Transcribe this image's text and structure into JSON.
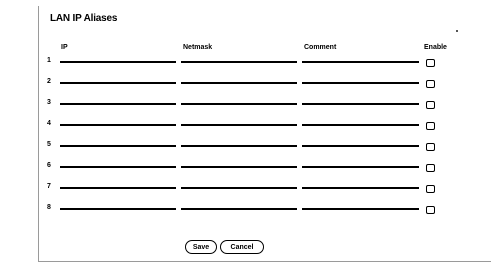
{
  "title": "LAN IP Aliases",
  "columns": {
    "ip": "IP",
    "netmask": "Netmask",
    "comment": "Comment",
    "enable": "Enable"
  },
  "rows": [
    {
      "num": "1",
      "ip": "",
      "netmask": "",
      "comment": "",
      "enabled": false
    },
    {
      "num": "2",
      "ip": "",
      "netmask": "",
      "comment": "",
      "enabled": false
    },
    {
      "num": "3",
      "ip": "",
      "netmask": "",
      "comment": "",
      "enabled": false
    },
    {
      "num": "4",
      "ip": "",
      "netmask": "",
      "comment": "",
      "enabled": false
    },
    {
      "num": "5",
      "ip": "",
      "netmask": "",
      "comment": "",
      "enabled": false
    },
    {
      "num": "6",
      "ip": "",
      "netmask": "",
      "comment": "",
      "enabled": false
    },
    {
      "num": "7",
      "ip": "",
      "netmask": "",
      "comment": "",
      "enabled": false
    },
    {
      "num": "8",
      "ip": "",
      "netmask": "",
      "comment": "",
      "enabled": false
    }
  ],
  "buttons": {
    "save": "Save",
    "cancel": "Cancel"
  }
}
